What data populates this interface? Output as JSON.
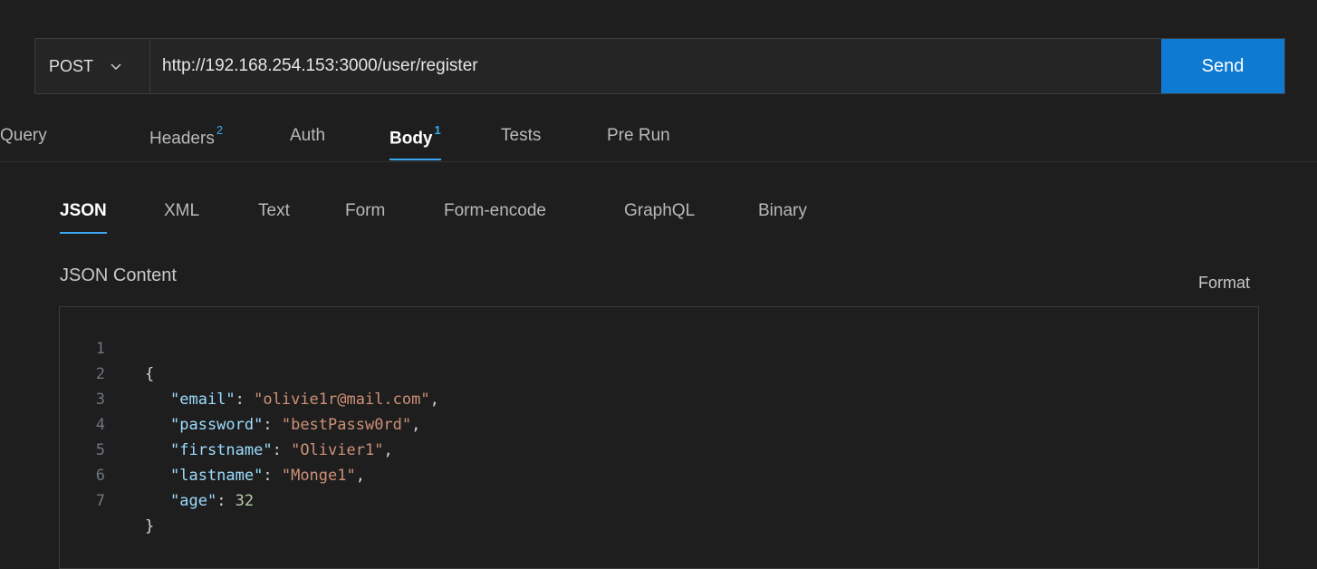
{
  "request": {
    "method": "POST",
    "url": "http://192.168.254.153:3000/user/register",
    "send_label": "Send"
  },
  "tabs": [
    {
      "label": "Query",
      "badge": ""
    },
    {
      "label": "Headers",
      "badge": "2"
    },
    {
      "label": "Auth",
      "badge": ""
    },
    {
      "label": "Body",
      "badge": "1"
    },
    {
      "label": "Tests",
      "badge": ""
    },
    {
      "label": "Pre Run",
      "badge": ""
    }
  ],
  "active_tab": "Body",
  "body_tabs": [
    "JSON",
    "XML",
    "Text",
    "Form",
    "Form-encode",
    "GraphQL",
    "Binary"
  ],
  "active_body_tab": "JSON",
  "editor": {
    "label": "JSON Content",
    "format_label": "Format",
    "lines": [
      {
        "n": "1",
        "text": "{"
      },
      {
        "n": "2",
        "key": "\"email\"",
        "value": "\"olivie1r@mail.com\"",
        "type": "str",
        "trail": ","
      },
      {
        "n": "3",
        "key": "\"password\"",
        "value": "\"bestPassw0rd\"",
        "type": "str",
        "trail": ","
      },
      {
        "n": "4",
        "key": "\"firstname\"",
        "value": "\"Olivier1\"",
        "type": "str",
        "trail": ","
      },
      {
        "n": "5",
        "key": "\"lastname\"",
        "value": "\"Monge1\"",
        "type": "str",
        "trail": ","
      },
      {
        "n": "6",
        "key": "\"age\"",
        "value": "32",
        "type": "num",
        "trail": ""
      },
      {
        "n": "7",
        "text": "}"
      }
    ]
  },
  "colors": {
    "accent": "#0e7ad1",
    "tab_indicator": "#3ba7f0",
    "json_key": "#9cdcfe",
    "json_string": "#ce9178",
    "json_number": "#b5cea8"
  },
  "icons": {
    "method_dropdown": "chevron-down-icon"
  }
}
